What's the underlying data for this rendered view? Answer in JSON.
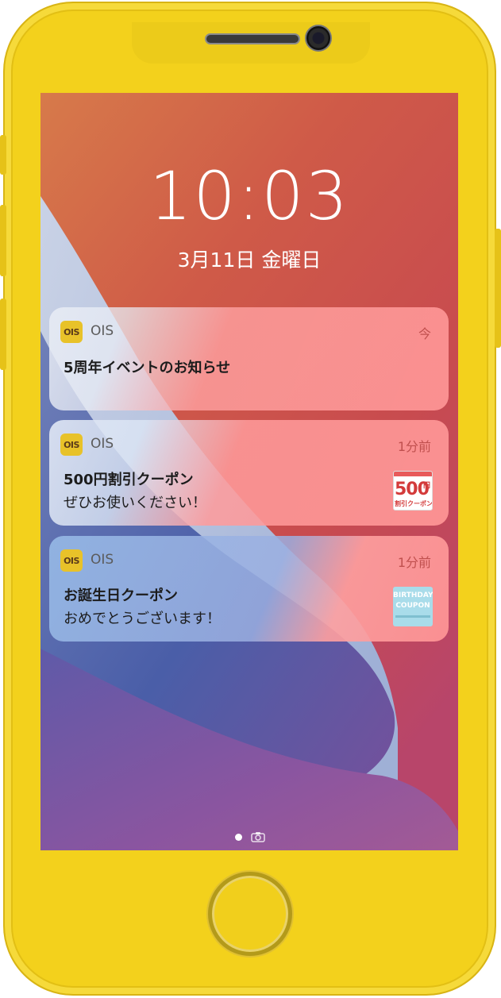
{
  "lock_screen": {
    "time": "10:03",
    "date": "3月11日 金曜日"
  },
  "notifications": [
    {
      "app_icon_text": "OIS",
      "app_name": "OIS",
      "time": "今",
      "title": "5周年イベントのお知らせ",
      "body": ""
    },
    {
      "app_icon_text": "OIS",
      "app_name": "OIS",
      "time": "1分前",
      "title": "500円割引クーポン",
      "body": "ぜひお使いください！",
      "thumbnail": {
        "big": "500",
        "unit": "円",
        "sub": "割引クーポン"
      }
    },
    {
      "app_icon_text": "OIS",
      "app_name": "OIS",
      "time": "1分前",
      "title": "お誕生日クーポン",
      "body": "おめでとうございます！",
      "thumbnail": {
        "line1": "BIRTHDAY",
        "line2": "COUPON"
      }
    }
  ],
  "footer": {
    "camera_icon": "camera-icon",
    "page_indicator": "page-dot"
  },
  "colors": {
    "phone_body": "#f3d11c",
    "accent_time": "#c0504e"
  }
}
